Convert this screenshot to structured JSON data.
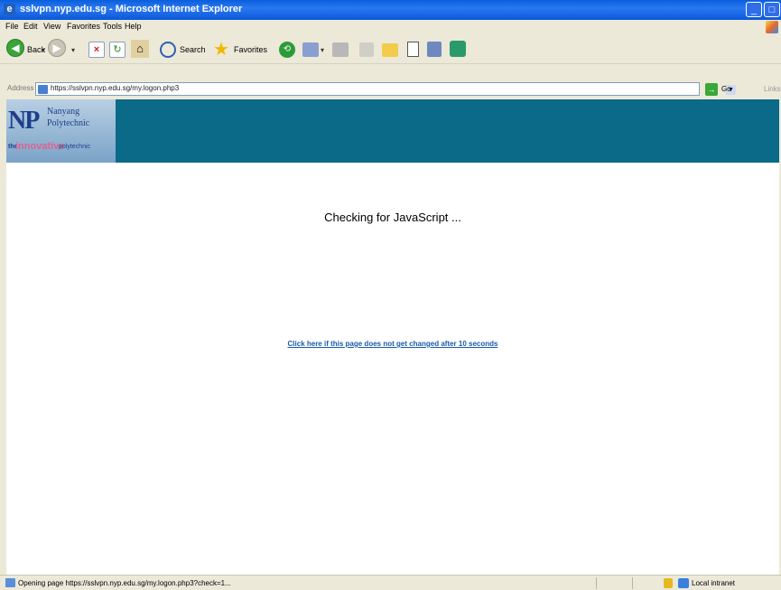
{
  "window": {
    "title": "sslvpn.nyp.edu.sg - Microsoft Internet Explorer"
  },
  "menu": [
    "File",
    "Edit",
    "View",
    "Favorites",
    "Tools",
    "Help"
  ],
  "toolbar": {
    "back_label": "Back",
    "search_label": "Search",
    "favorites_label": "Favorites"
  },
  "address": {
    "label": "Address",
    "url": "https://sslvpn.nyp.edu.sg/my.logon.php3",
    "go_label": "Go",
    "links_label": "Links"
  },
  "banner": {
    "logo_letters": "NP",
    "school_line1": "Nanyang",
    "school_line2": "Polytechnic",
    "tagline_prefix": "the",
    "tagline_word": "innovative",
    "tagline_suffix": "polytechnic",
    "color": "#0a6a88"
  },
  "page": {
    "status_message": "Checking for JavaScript ...",
    "fallback_link": "Click here if this page does not get changed after 10 seconds"
  },
  "statusbar": {
    "text": "Opening page https://sslvpn.nyp.edu.sg/my.logon.php3?check=1...",
    "zone": "Local intranet"
  }
}
